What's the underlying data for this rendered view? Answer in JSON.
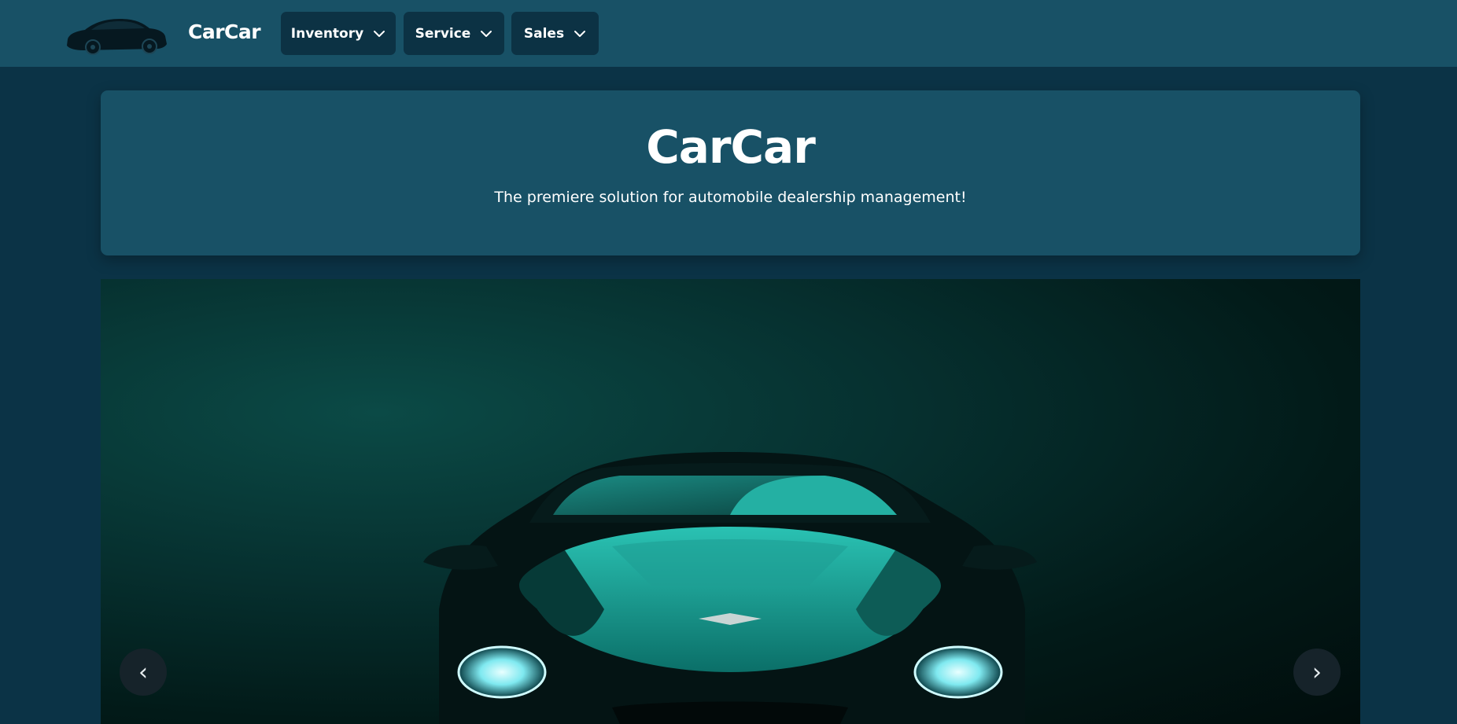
{
  "nav": {
    "brand": "CarCar",
    "menus": [
      {
        "label": "Inventory"
      },
      {
        "label": "Service"
      },
      {
        "label": "Sales"
      }
    ]
  },
  "hero": {
    "title": "CarCar",
    "subtitle": "The premiere solution for automobile dealership management!"
  },
  "carousel": {
    "prev_label": "‹",
    "next_label": "›"
  },
  "colors": {
    "page_bg": "#0b3346",
    "navbar_bg": "#185166",
    "nav_button_bg": "#0c3244",
    "hero_bg": "#185166",
    "car_accent": "#1fb5a8"
  },
  "icons": {
    "brand": "car-silhouette-icon",
    "menu": "chevron-down-icon"
  }
}
